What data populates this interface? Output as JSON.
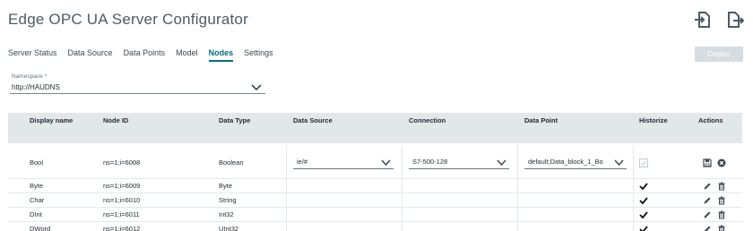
{
  "app": {
    "title": "Edge OPC UA Server Configurator"
  },
  "header": {
    "import_icon": "import-icon",
    "export_icon": "export-icon",
    "deploy_label": "Deploy"
  },
  "tabs": [
    {
      "label": "Server Status",
      "active": false
    },
    {
      "label": "Data Source",
      "active": false
    },
    {
      "label": "Data Points",
      "active": false
    },
    {
      "label": "Model",
      "active": false
    },
    {
      "label": "Nodes",
      "active": true
    },
    {
      "label": "Settings",
      "active": false
    }
  ],
  "namespace": {
    "label": "Namespace *",
    "value": "http://HAUDNS"
  },
  "table": {
    "columns": [
      "Display name",
      "Node ID",
      "Data Type",
      "Data Source",
      "Connection",
      "Data Point",
      "Historize",
      "Actions"
    ],
    "edit_row": {
      "display_name": "Bool",
      "node_id": "ns=1;i=6008",
      "data_type": "Boolean",
      "data_source": "ie/#",
      "connection": "S7-500-128",
      "data_point": "default;Data_block_1_Bo"
    },
    "rows": [
      {
        "display_name": "Byte",
        "node_id": "ns=1;i=6009",
        "data_type": "Byte",
        "historize": true
      },
      {
        "display_name": "Char",
        "node_id": "ns=1;i=6010",
        "data_type": "String",
        "historize": true
      },
      {
        "display_name": "DInt",
        "node_id": "ns=1;i=6011",
        "data_type": "Int32",
        "historize": true
      },
      {
        "display_name": "DWord",
        "node_id": "ns=1;i=6012",
        "data_type": "UInt32",
        "historize": true
      }
    ]
  },
  "colors": {
    "accent": "#00707e",
    "header_bg": "#e2e7ea",
    "deploy_disabled": "#d6dde2"
  }
}
